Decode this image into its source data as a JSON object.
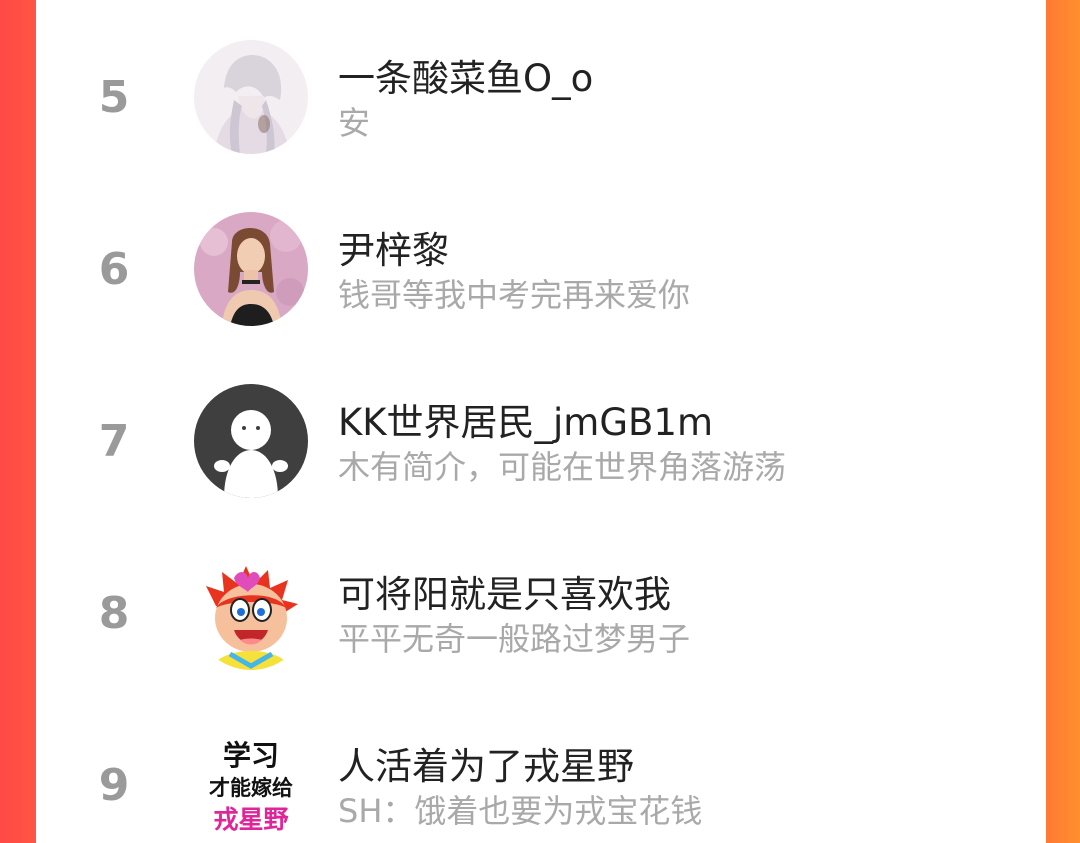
{
  "ranking": {
    "items": [
      {
        "rank": "5",
        "name": "一条酸菜鱼O_o",
        "bio": "安",
        "avatar_icon": "anime-character-avatar"
      },
      {
        "rank": "6",
        "name": "尹梓黎",
        "bio": "钱哥等我中考完再来爱你",
        "avatar_icon": "woman-photo-avatar"
      },
      {
        "rank": "7",
        "name": "KK世界居民_jmGB1m",
        "bio": "木有简介，可能在世界角落游荡",
        "avatar_icon": "default-person-avatar"
      },
      {
        "rank": "8",
        "name": "可将阳就是只喜欢我",
        "bio": "平平无奇一般路过梦男子",
        "avatar_icon": "cartoon-boy-avatar"
      },
      {
        "rank": "9",
        "name": "人活着为了戎星野",
        "bio": "SH：饿着也要为戎宝花钱",
        "avatar_icon": "text-avatar"
      }
    ],
    "avatar_text": {
      "line1": "学习",
      "line2": "才能嫁给",
      "line3": "戎星野"
    }
  },
  "colors": {
    "left_border": "#ff4a45",
    "right_border": "#ff8f2e",
    "rank_gray": "#9a9a9a",
    "name_color": "#222222",
    "bio_color": "#a9a9a9"
  }
}
